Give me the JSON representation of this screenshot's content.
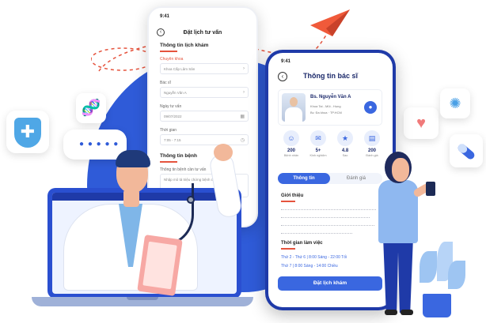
{
  "booking_screen": {
    "status_time": "9:41",
    "title": "Đặt lịch tư vấn",
    "section1_title": "Thông tin lịch khám",
    "field_specialty_label": "Chuyên khoa",
    "field_specialty_value": "Khoa Cấp Lâm Sản",
    "field_doctor_label": "Bác sĩ",
    "field_doctor_value": "Nguyễn Văn A",
    "field_date_label": "Ngày tư vấn",
    "field_date_value": "09/07/2022",
    "field_time_label": "Thời gian",
    "field_time_value": "7:05 - 7:15",
    "section2_title": "Thông tin bệnh",
    "field_need_label": "Thông tin bệnh cần tư vấn",
    "field_need_placeholder": "Nhập mô tả triệu chứng bệnh cho bác sĩ"
  },
  "doctor_screen": {
    "status_time": "9:41",
    "title": "Thông tin bác sĩ",
    "doctor_name": "Bs. Nguyễn Văn A",
    "doctor_specialty": "Khoa Tai - Mũi - Họng",
    "doctor_hospital": "Bv. Đa khoa · TP.HCM",
    "stats": [
      {
        "value": "200",
        "label": "Bệnh nhân",
        "icon": "users-icon"
      },
      {
        "value": "5+",
        "label": "Kinh nghiệm",
        "icon": "chat-icon"
      },
      {
        "value": "4.8",
        "label": "Sao",
        "icon": "star-icon"
      },
      {
        "value": "200",
        "label": "Đánh giá",
        "icon": "review-icon"
      }
    ],
    "tab_active": "Thông tin",
    "tab_inactive": "Đánh giá",
    "intro_title": "Giới thiệu",
    "schedule_title": "Thời gian làm việc",
    "schedule_line1": "Thứ 2 - Thứ 6 | 8:00 Sáng - 22:00 Tối",
    "schedule_line2": "Thứ 7 | 8:00 Sáng - 14:00 Chiều",
    "book_button": "Đặt lịch khám"
  },
  "colors": {
    "primary": "#3a67e0",
    "dark_blue": "#1f3aa8",
    "accent_red": "#e5533d"
  },
  "icons": [
    "shield-plus-icon",
    "dna-icon",
    "heart-pulse-icon",
    "virus-icon",
    "pill-icon",
    "paper-plane-icon"
  ]
}
